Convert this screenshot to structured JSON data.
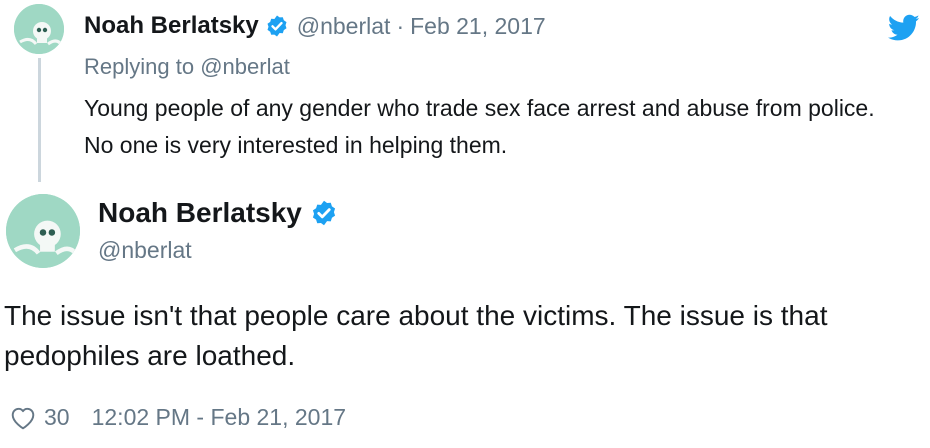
{
  "parent_tweet": {
    "display_name": "Noah Berlatsky",
    "handle": "@nberlat",
    "separator": "·",
    "date": "Feb 21, 2017",
    "replying_prefix": "Replying to",
    "replying_to": "@nberlat",
    "text": "Young people of any gender who trade sex face arrest and abuse from police. No one is very interested in helping them."
  },
  "main_tweet": {
    "display_name": "Noah Berlatsky",
    "handle": "@nberlat",
    "text": "The issue isn't that people care about the victims. The issue is that pedophiles are loathed.",
    "like_count": "30",
    "timestamp": "12:02 PM - Feb 21, 2017"
  },
  "icons": {
    "verified": "verified-badge-icon",
    "brand": "twitter-bird-icon",
    "like": "heart-icon",
    "avatar": "skull-avatar"
  },
  "colors": {
    "brand_blue": "#1da1f2",
    "text_primary": "#14171a",
    "text_secondary": "#657786",
    "thread_line": "#ccd6dd",
    "avatar_bg": "#9fd8c4"
  }
}
